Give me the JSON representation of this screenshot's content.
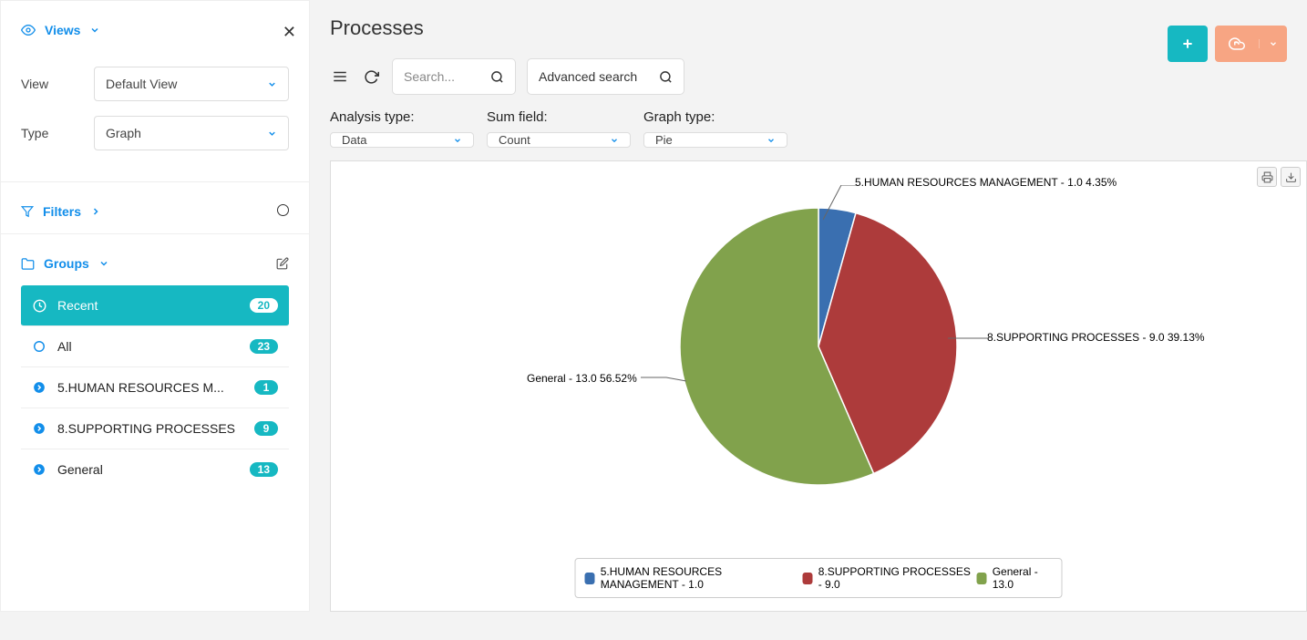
{
  "page_title": "Processes",
  "sidebar": {
    "views_label": "Views",
    "view_label": "View",
    "view_value": "Default View",
    "type_label": "Type",
    "type_value": "Graph",
    "filters_label": "Filters",
    "groups_label": "Groups",
    "groups": [
      {
        "label": "Recent",
        "count": "20",
        "icon": "clock",
        "active": true
      },
      {
        "label": "All",
        "count": "23",
        "icon": "circle",
        "active": false
      },
      {
        "label": "5.HUMAN RESOURCES M...",
        "count": "1",
        "icon": "arrow",
        "active": false
      },
      {
        "label": "8.SUPPORTING PROCESSES",
        "count": "9",
        "icon": "arrow",
        "active": false
      },
      {
        "label": "General",
        "count": "13",
        "icon": "arrow",
        "active": false
      }
    ]
  },
  "toolbar": {
    "search_placeholder": "Search...",
    "advanced_search": "Advanced search"
  },
  "controls": {
    "analysis_label": "Analysis type:",
    "analysis_value": "Data",
    "sum_label": "Sum field:",
    "sum_value": "Count",
    "graph_label": "Graph type:",
    "graph_value": "Pie"
  },
  "colors": {
    "blue": "#3a6fb0",
    "red": "#ad3b3b",
    "green": "#81a24c",
    "teal": "#16b8c2",
    "orange": "#f7a583"
  },
  "chart_data": {
    "type": "pie",
    "series": [
      {
        "name": "5.HUMAN RESOURCES MANAGEMENT",
        "value": 1.0,
        "percent": 4.35,
        "color": "#3a6fb0"
      },
      {
        "name": "8.SUPPORTING PROCESSES",
        "value": 9.0,
        "percent": 39.13,
        "color": "#ad3b3b"
      },
      {
        "name": "General",
        "value": 13.0,
        "percent": 56.52,
        "color": "#81a24c"
      }
    ],
    "labels": {
      "hr": "5.HUMAN RESOURCES MANAGEMENT - 1.0 4.35%",
      "supporting": "8.SUPPORTING PROCESSES - 9.0 39.13%",
      "general": "General - 13.0 56.52%"
    },
    "legend": [
      "5.HUMAN RESOURCES MANAGEMENT - 1.0",
      "8.SUPPORTING PROCESSES - 9.0",
      "General - 13.0"
    ]
  }
}
